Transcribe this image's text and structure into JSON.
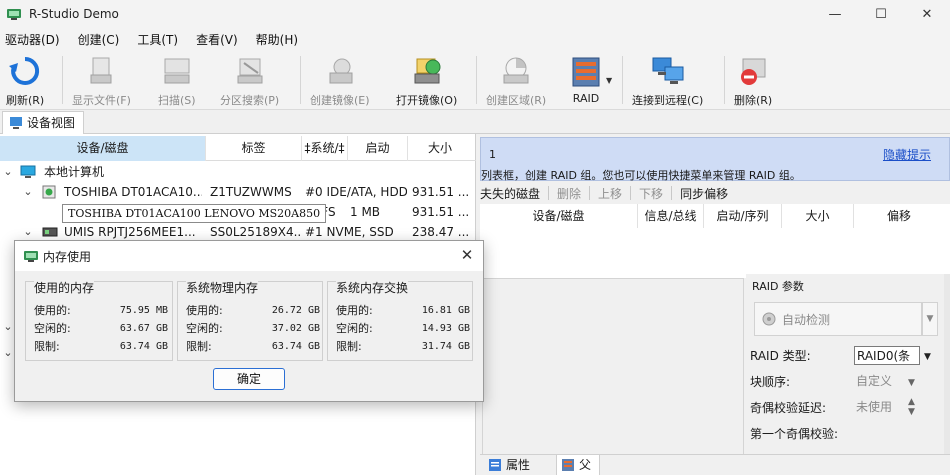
{
  "window": {
    "title": "R-Studio Demo",
    "minimize": "—",
    "maximize": "☐",
    "close": "✕"
  },
  "menu": [
    "驱动器(D)",
    "创建(C)",
    "工具(T)",
    "查看(V)",
    "帮助(H)"
  ],
  "toolbar": {
    "refresh": "刷新(R)",
    "show_files": "显示文件(F)",
    "scan": "扫描(S)",
    "partition_search": "分区搜索(P)",
    "create_image": "创建镜像(E)",
    "open_image": "打开镜像(O)",
    "create_region": "创建区域(R)",
    "raid": "RAID",
    "connect_remote": "连接到远程(C)",
    "delete": "删除(R)"
  },
  "tabs": {
    "device_view": "设备视图"
  },
  "device_table": {
    "headers": [
      "设备/磁盘",
      "标签",
      "‡系统/‡",
      "启动",
      "大小"
    ],
    "rows": [
      {
        "name": "本地计算机",
        "label": "",
        "fs": "",
        "start": "",
        "size": ""
      },
      {
        "name": "TOSHIBA DT01ACA10...",
        "label": "Z1TUZWWMS",
        "fs": "#0 IDE/ATA, HDD",
        "start": "",
        "size": "931.51 ..."
      },
      {
        "name": "",
        "label": "",
        "fs": "NTFS",
        "start": "1 MB",
        "size": "931.51 ..."
      },
      {
        "name": "UMIS RPJTJ256MEE1...",
        "label": "SS0L25189X4...",
        "fs": "#1 NVME, SSD",
        "start": "",
        "size": "238.47 ..."
      }
    ],
    "tooltip": "TOSHIBA DT01ACA100 LENOVO MS20A850"
  },
  "right_panel": {
    "hint_number": "1",
    "hint_text": "列表框，创建 RAID 组。您也可以使用快捷菜单来管理 RAID 组。",
    "hide_hint": "隐藏提示",
    "toolbar": {
      "missing_disk": "夫失的磁盘",
      "delete": "删除",
      "move_up": "上移",
      "move_down": "下移",
      "sync_offset": "同步偏移"
    },
    "headers": [
      "设备/磁盘",
      "信息/总线",
      "启动/序列",
      "大小",
      "偏移"
    ],
    "raid_params": {
      "title": "RAID 参数",
      "auto_detect": "自动检测",
      "raid_type_label": "RAID 类型:",
      "raid_type_value": "RAID0(条",
      "block_order_label": "块顺序:",
      "block_order_value": "自定义",
      "parity_delay_label": "奇偶校验延迟:",
      "parity_delay_value": "未使用",
      "next_label": "第一个奇偶校验:"
    },
    "bottom_tabs": {
      "properties": "属性",
      "parent": "父"
    }
  },
  "dialog": {
    "title": "内存使用",
    "ok": "确定",
    "groups": [
      {
        "title": "使用的内存",
        "rows": [
          {
            "label": "使用的:",
            "value": "75.95 MB"
          },
          {
            "label": "空闲的:",
            "value": "63.67 GB"
          },
          {
            "label": "限制:",
            "value": "63.74 GB"
          }
        ]
      },
      {
        "title": "系统物理内存",
        "rows": [
          {
            "label": "使用的:",
            "value": "26.72 GB"
          },
          {
            "label": "空闲的:",
            "value": "37.02 GB"
          },
          {
            "label": "限制:",
            "value": "63.74 GB"
          }
        ]
      },
      {
        "title": "系统内存交换",
        "rows": [
          {
            "label": "使用的:",
            "value": "16.81 GB"
          },
          {
            "label": "空闲的:",
            "value": "14.93 GB"
          },
          {
            "label": "限制:",
            "value": "31.74 GB"
          }
        ]
      }
    ]
  },
  "colors": {
    "selection": "#cce4f7",
    "hint_bg": "#cfdcf5",
    "link": "#1a4ec8",
    "accent_button_border": "#2b6fd4"
  }
}
